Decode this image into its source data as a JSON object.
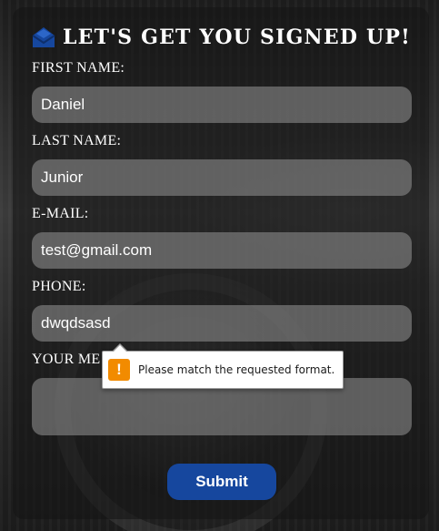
{
  "form": {
    "title": "LET'S GET YOU SIGNED UP!",
    "title_icon": "envelope-open-icon",
    "fields": [
      {
        "label": "FIRST NAME:",
        "value": "Daniel"
      },
      {
        "label": "LAST NAME:",
        "value": "Junior"
      },
      {
        "label": "E-MAIL:",
        "value": "test@gmail.com"
      },
      {
        "label": "PHONE:",
        "value": "dwqdsasd"
      },
      {
        "label": "YOUR ME",
        "value": ""
      }
    ],
    "submit_label": "Submit"
  },
  "validation_tooltip": {
    "icon": "warning-icon",
    "icon_glyph": "!",
    "message": "Please match the requested format."
  },
  "colors": {
    "accent": "#16479e",
    "warning": "#f28b00"
  }
}
